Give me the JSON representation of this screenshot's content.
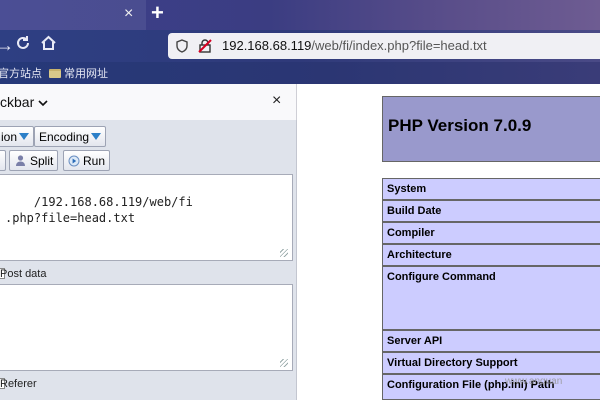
{
  "browser": {
    "tab_close_glyph": "×",
    "new_tab_glyph": "+",
    "url_host": "192.168.68.119",
    "url_path": "/web/fi/index.php?file=head.txt",
    "bookmarks": [
      {
        "label": "官方站点",
        "icon": "globe-icon"
      },
      {
        "label": "常用网址",
        "icon": "folder-icon"
      }
    ]
  },
  "hackbar": {
    "title": "ckbar",
    "close_glyph": "×",
    "toolbar": {
      "dropdown1_label": "ion",
      "encoding_label": "Encoding",
      "split_label": "Split",
      "run_label": "Run"
    },
    "url_textarea_lines": "/192.168.68.119/web/fi\n.php?file=head.txt",
    "post_data_label": "Post data",
    "referer_label": "Referer"
  },
  "phpinfo": {
    "title": "PHP Version 7.0.9",
    "rows": [
      "System",
      "Build Date",
      "Compiler",
      "Architecture",
      "Configure Command",
      "Server API",
      "Virtual Directory Support",
      "Configuration File (php.ini) Path"
    ]
  },
  "watermark": "www.anquan",
  "colors": {
    "php_header": "#9999cc",
    "php_row": "#ccccff",
    "encoding_arrow": "#2a7ec8"
  }
}
